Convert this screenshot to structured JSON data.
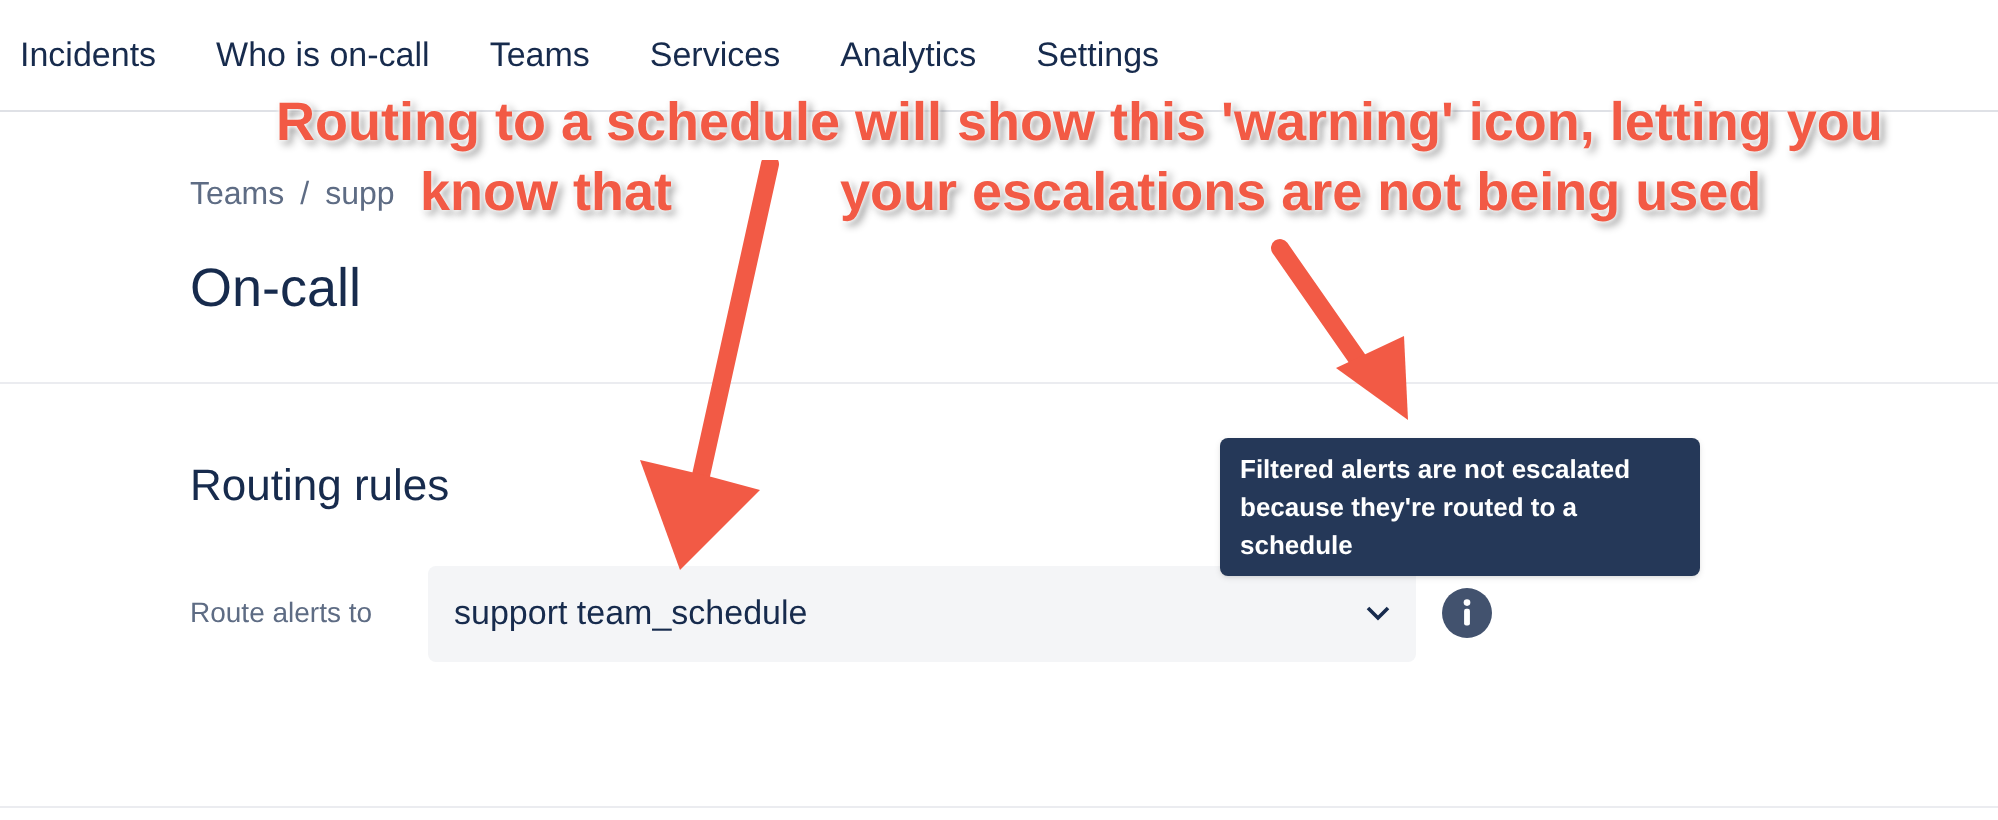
{
  "nav": {
    "items": [
      {
        "label": "Incidents"
      },
      {
        "label": "Who is on-call"
      },
      {
        "label": "Teams"
      },
      {
        "label": "Services"
      },
      {
        "label": "Analytics"
      },
      {
        "label": "Settings"
      }
    ]
  },
  "breadcrumb": {
    "items": [
      "Teams",
      "supp"
    ],
    "separator": "/"
  },
  "page_title": "On-call",
  "routing": {
    "title": "Routing rules",
    "label": "Route alerts to",
    "value": "support team_schedule",
    "tooltip": "Filtered alerts are not escalated because they're routed to a schedule"
  },
  "annotation": {
    "lines": [
      "Routing to a schedule will show this 'warning' icon, letting you",
      "know that",
      "your escalations are not being used"
    ]
  }
}
